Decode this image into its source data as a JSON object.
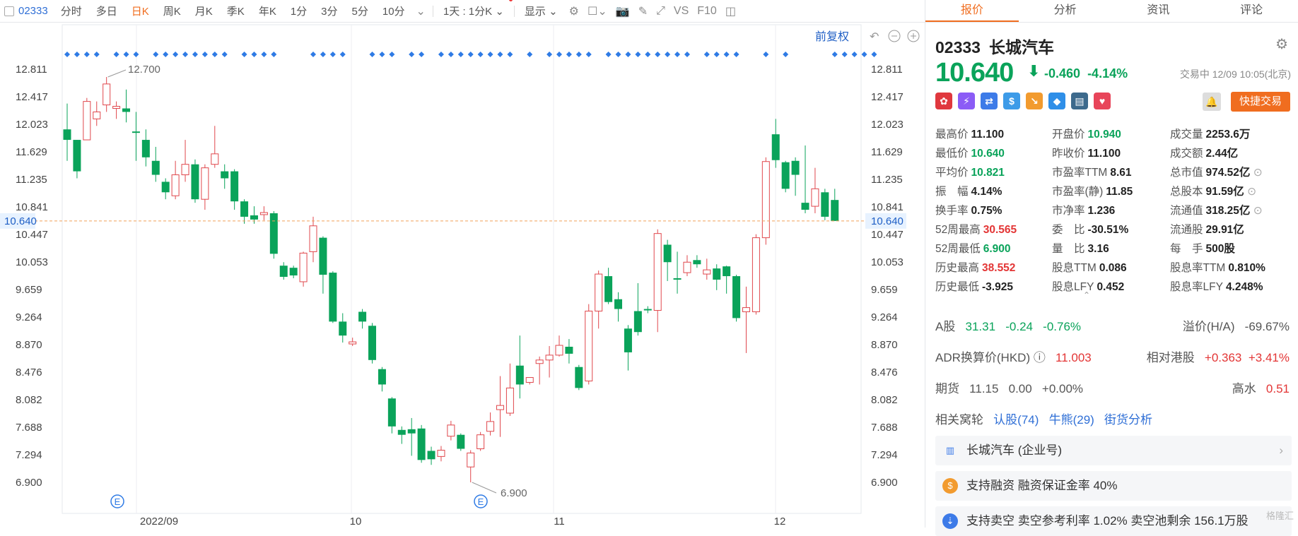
{
  "toolbar": {
    "code": "02333",
    "tabs": [
      "分时",
      "多日",
      "日K",
      "周K",
      "月K",
      "季K",
      "年K",
      "1分",
      "3分",
      "5分",
      "10分"
    ],
    "active_tab": "日K",
    "mode": "1天 : 1分K",
    "display_label": "显示",
    "vs_label": "VS",
    "f10_label": "F10"
  },
  "chart_header": {
    "adjust_label": "前复权"
  },
  "side": {
    "tabs": [
      "报价",
      "分析",
      "资讯",
      "评论"
    ],
    "active_tab": "报价",
    "code": "02333",
    "name": "长城汽车",
    "price": "10.640",
    "change": "-0.460",
    "change_pct": "-4.14%",
    "status": "交易中 12/09 10:05(北京)",
    "trade_label": "快捷交易",
    "grid": [
      [
        {
          "k": "最高价",
          "v": "11.100",
          "c": "n"
        },
        {
          "k": "开盘价",
          "v": "10.940",
          "c": "g"
        },
        {
          "k": "成交量",
          "v": "2253.6万",
          "c": "n"
        }
      ],
      [
        {
          "k": "最低价",
          "v": "10.640",
          "c": "g"
        },
        {
          "k": "昨收价",
          "v": "11.100",
          "c": "n"
        },
        {
          "k": "成交额",
          "v": "2.44亿",
          "c": "n"
        }
      ],
      [
        {
          "k": "平均价",
          "v": "10.821",
          "c": "g"
        },
        {
          "k": "市盈率TTM",
          "v": "8.61",
          "c": "n"
        },
        {
          "k": "总市值",
          "v": "974.52亿",
          "c": "n"
        }
      ],
      [
        {
          "k": "振　幅",
          "v": "4.14%",
          "c": "n"
        },
        {
          "k": "市盈率(静)",
          "v": "11.85",
          "c": "n"
        },
        {
          "k": "总股本",
          "v": "91.59亿",
          "c": "n"
        }
      ],
      [
        {
          "k": "换手率",
          "v": "0.75%",
          "c": "n"
        },
        {
          "k": "市净率",
          "v": "1.236",
          "c": "n"
        },
        {
          "k": "流通值",
          "v": "318.25亿",
          "c": "n"
        }
      ],
      [
        {
          "k": "52周最高",
          "v": "30.565",
          "c": "r"
        },
        {
          "k": "委　比",
          "v": "-30.51%",
          "c": "n"
        },
        {
          "k": "流通股",
          "v": "29.91亿",
          "c": "n"
        }
      ],
      [
        {
          "k": "52周最低",
          "v": "6.900",
          "c": "g"
        },
        {
          "k": "量　比",
          "v": "3.16",
          "c": "n"
        },
        {
          "k": "每　手",
          "v": "500股",
          "c": "n"
        }
      ],
      [
        {
          "k": "历史最高",
          "v": "38.552",
          "c": "r"
        },
        {
          "k": "股息TTM",
          "v": "0.086",
          "c": "n"
        },
        {
          "k": "股息率TTM",
          "v": "0.810%",
          "c": "n"
        }
      ],
      [
        {
          "k": "历史最低",
          "v": "-3.925",
          "c": "n"
        },
        {
          "k": "股息LFY",
          "v": "0.452",
          "c": "n"
        },
        {
          "k": "股息率LFY",
          "v": "4.248%",
          "c": "n"
        }
      ]
    ],
    "a_share": {
      "label": "A股",
      "price": "31.31",
      "chg": "-0.24",
      "pct": "-0.76%",
      "prem_label": "溢价(H/A)",
      "prem": "-69.67%"
    },
    "adr": {
      "label": "ADR换算价(HKD)",
      "price": "11.003",
      "rel_label": "相对港股",
      "chg": "+0.363",
      "pct": "+3.41%"
    },
    "futures": {
      "label": "期货",
      "price": "11.15",
      "chg": "0.00",
      "pct": "+0.00%",
      "hi_label": "高水",
      "hi": "0.51"
    },
    "warrants": {
      "label": "相关窝轮",
      "bull": "认股(74)",
      "bear": "牛熊(29)",
      "street": "街货分析"
    },
    "cards": [
      "长城汽车 (企业号)",
      "支持融资 融资保证金率 40%",
      "支持卖空 卖空参考利率 1.02% 卖空池剩余 156.1万股"
    ],
    "watermark": "格隆汇"
  },
  "chart_data": {
    "type": "candlestick",
    "y_ticks": [
      "12.811",
      "12.417",
      "12.023",
      "11.629",
      "11.235",
      "10.841",
      "10.447",
      "10.053",
      "9.659",
      "9.264",
      "8.870",
      "8.476",
      "8.082",
      "7.688",
      "7.294",
      "6.900"
    ],
    "ylim": [
      6.9,
      12.811
    ],
    "x_ticks": [
      "2022/09",
      "10",
      "11",
      "12"
    ],
    "current_price": "10.640",
    "max_label": "12.700",
    "min_label": "6.900",
    "event_label": "E",
    "candles": [
      [
        11.95,
        11.8,
        12.32,
        11.5
      ],
      [
        11.8,
        11.35,
        11.8,
        11.25
      ],
      [
        11.8,
        12.35,
        12.4,
        11.8
      ],
      [
        12.1,
        12.2,
        12.35,
        12.0
      ],
      [
        12.3,
        12.6,
        12.7,
        12.2
      ],
      [
        12.25,
        12.28,
        12.35,
        12.1
      ],
      [
        12.25,
        12.2,
        12.52,
        12.05
      ],
      [
        11.92,
        11.9,
        12.2,
        11.5
      ],
      [
        11.8,
        11.55,
        11.95,
        11.42
      ],
      [
        11.5,
        11.3,
        11.7,
        11.2
      ],
      [
        11.2,
        11.05,
        11.25,
        10.95
      ],
      [
        11.0,
        11.3,
        11.5,
        10.95
      ],
      [
        11.3,
        11.45,
        11.8,
        11.2
      ],
      [
        11.45,
        10.95,
        11.52,
        10.9
      ],
      [
        10.95,
        11.4,
        11.45,
        10.8
      ],
      [
        11.45,
        11.6,
        12.0,
        11.4
      ],
      [
        11.35,
        11.25,
        11.45,
        11.1
      ],
      [
        11.35,
        10.92,
        11.38,
        10.8
      ],
      [
        10.92,
        10.7,
        10.95,
        10.6
      ],
      [
        10.72,
        10.66,
        10.85,
        10.6
      ],
      [
        10.73,
        10.76,
        10.85,
        10.65
      ],
      [
        10.75,
        10.17,
        10.78,
        10.1
      ],
      [
        10.0,
        9.84,
        10.05,
        9.8
      ],
      [
        9.97,
        9.86,
        10.0,
        9.82
      ],
      [
        9.77,
        10.18,
        10.2,
        9.7
      ],
      [
        10.2,
        10.57,
        10.7,
        10.05
      ],
      [
        10.4,
        9.87,
        10.42,
        9.6
      ],
      [
        9.9,
        9.2,
        9.92,
        9.18
      ],
      [
        9.2,
        9.0,
        9.32,
        8.9
      ],
      [
        8.88,
        8.91,
        8.97,
        8.85
      ],
      [
        9.34,
        9.2,
        9.38,
        9.1
      ],
      [
        9.14,
        8.65,
        9.18,
        8.6
      ],
      [
        8.52,
        8.3,
        8.55,
        8.2
      ],
      [
        8.1,
        7.7,
        8.12,
        7.6
      ],
      [
        7.65,
        7.58,
        7.7,
        7.45
      ],
      [
        7.66,
        7.6,
        7.82,
        7.28
      ],
      [
        7.67,
        7.22,
        7.72,
        7.18
      ],
      [
        7.35,
        7.23,
        7.41,
        7.15
      ],
      [
        7.27,
        7.36,
        7.42,
        7.2
      ],
      [
        7.56,
        7.72,
        7.78,
        7.5
      ],
      [
        7.58,
        7.38,
        7.6,
        7.35
      ],
      [
        7.12,
        7.32,
        7.36,
        6.9
      ],
      [
        7.38,
        7.58,
        7.62,
        7.35
      ],
      [
        7.63,
        7.77,
        7.9,
        7.57
      ],
      [
        7.94,
        8.0,
        8.42,
        7.55
      ],
      [
        7.89,
        8.25,
        8.6,
        7.85
      ],
      [
        8.57,
        8.3,
        9.0,
        8.1
      ],
      [
        8.33,
        8.4,
        8.4,
        8.3
      ],
      [
        8.6,
        8.65,
        8.7,
        8.3
      ],
      [
        8.65,
        8.72,
        8.85,
        8.4
      ],
      [
        8.72,
        8.86,
        9.0,
        8.7
      ],
      [
        8.84,
        8.74,
        8.95,
        8.6
      ],
      [
        8.55,
        8.25,
        8.58,
        8.22
      ],
      [
        8.35,
        9.35,
        9.45,
        8.3
      ],
      [
        9.35,
        9.88,
        9.93,
        9.1
      ],
      [
        9.85,
        9.48,
        9.97,
        9.45
      ],
      [
        9.52,
        9.38,
        9.62,
        9.2
      ],
      [
        9.1,
        8.76,
        9.15,
        8.5
      ],
      [
        9.35,
        9.05,
        9.75,
        9.0
      ],
      [
        9.38,
        9.36,
        9.42,
        9.32
      ],
      [
        9.36,
        10.46,
        10.52,
        9.05
      ],
      [
        10.3,
        10.05,
        10.37,
        9.78
      ],
      [
        9.82,
        9.8,
        10.2,
        9.6
      ],
      [
        9.9,
        10.05,
        10.15,
        9.85
      ],
      [
        10.08,
        10.02,
        10.15,
        9.97
      ],
      [
        9.88,
        9.94,
        10.1,
        9.8
      ],
      [
        9.96,
        9.8,
        10.02,
        9.65
      ],
      [
        9.99,
        9.85,
        10.0,
        9.6
      ],
      [
        9.85,
        9.25,
        9.87,
        9.2
      ],
      [
        9.34,
        9.4,
        9.7,
        8.75
      ],
      [
        9.34,
        10.4,
        10.45,
        9.3
      ],
      [
        10.4,
        11.49,
        11.55,
        10.3
      ],
      [
        11.88,
        11.51,
        12.1,
        11.4
      ],
      [
        11.48,
        11.1,
        11.5,
        11.05
      ],
      [
        11.5,
        11.3,
        11.55,
        11.0
      ],
      [
        10.9,
        10.8,
        11.72,
        10.75
      ],
      [
        10.85,
        11.1,
        11.4,
        10.75
      ],
      [
        11.05,
        10.7,
        11.1,
        10.65
      ],
      [
        10.94,
        10.64,
        11.1,
        10.64
      ]
    ],
    "signal_slots": [
      0,
      1,
      2,
      3,
      5,
      6,
      7,
      9,
      10,
      11,
      12,
      13,
      14,
      15,
      16,
      18,
      19,
      20,
      21,
      25,
      26,
      27,
      28,
      31,
      32,
      33,
      35,
      36,
      38,
      39,
      40,
      41,
      42,
      43,
      44,
      45,
      47,
      49,
      50,
      51,
      52,
      53,
      55,
      56,
      57,
      58,
      59,
      60,
      61,
      62,
      63,
      65,
      66,
      67,
      68,
      71,
      73,
      78,
      79,
      80,
      81,
      82
    ]
  }
}
